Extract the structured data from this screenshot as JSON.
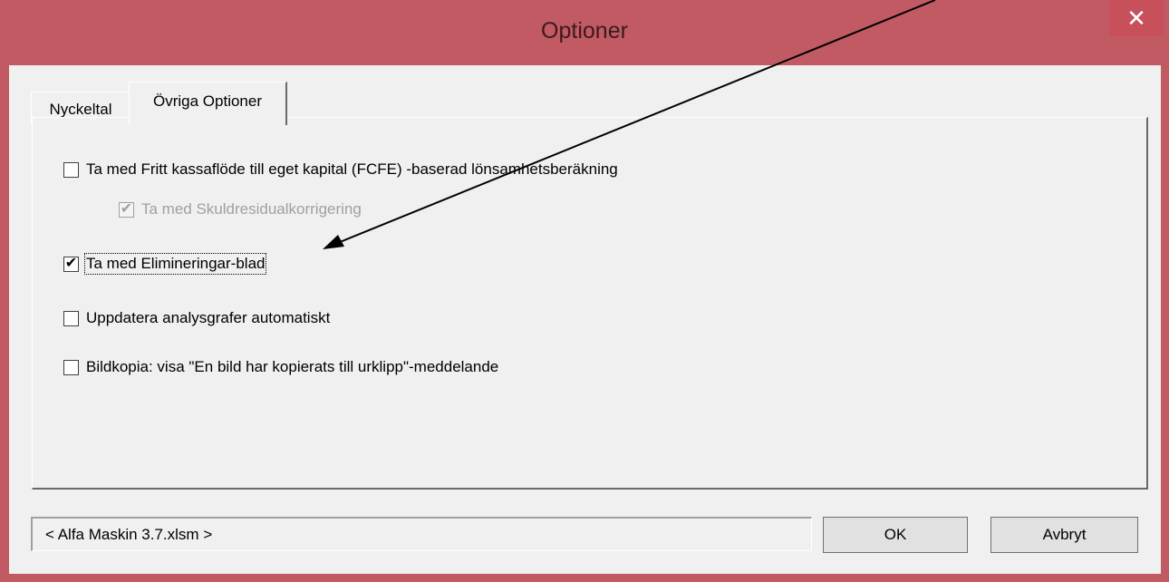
{
  "window": {
    "title": "Optioner",
    "close_glyph": "✕",
    "title_bar_color": "#c15a63"
  },
  "tabs": [
    {
      "label": "Nyckeltal",
      "active": false
    },
    {
      "label": "Övriga Optioner",
      "active": true
    }
  ],
  "options": [
    {
      "label": "Ta med Fritt kassaflöde till eget kapital (FCFE) -baserad lönsamhetsberäkning",
      "checked": false,
      "enabled": true
    },
    {
      "label": "Ta med Skuldresidualkorrigering",
      "checked": true,
      "enabled": false
    },
    {
      "label": "Ta med Elimineringar-blad",
      "checked": true,
      "enabled": true,
      "focused": true
    },
    {
      "label": "Uppdatera analysgrafer automatiskt",
      "checked": false,
      "enabled": true
    },
    {
      "label": "Bildkopia: visa \"En bild har kopierats till urklipp\"-meddelande",
      "checked": false,
      "enabled": true
    }
  ],
  "check_glyph": "✔",
  "status_text": "< Alfa Maskin 3.7.xlsm >",
  "buttons": {
    "ok": "OK",
    "cancel": "Avbryt"
  },
  "annotation": {
    "icon": "arrow-icon",
    "color": "#000000"
  }
}
